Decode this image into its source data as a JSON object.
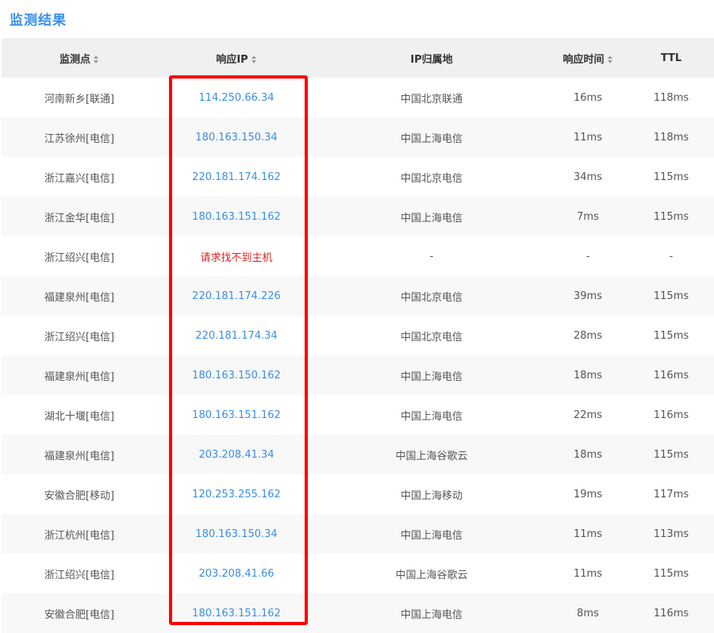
{
  "title": "监测结果",
  "columns": {
    "location": "监测点",
    "ip": "响应IP",
    "region": "IP归属地",
    "time": "响应时间",
    "ttl": "TTL"
  },
  "colors": {
    "accent": "#3a8ee6",
    "error": "#e02020",
    "highlight": "#ff0000"
  },
  "rows": [
    {
      "location": "河南新乡[联通]",
      "ip": "114.250.66.34",
      "ip_status": "ok",
      "region": "中国北京联通",
      "time": "16ms",
      "ttl": "118ms"
    },
    {
      "location": "江苏徐州[电信]",
      "ip": "180.163.150.34",
      "ip_status": "ok",
      "region": "中国上海电信",
      "time": "11ms",
      "ttl": "118ms"
    },
    {
      "location": "浙江嘉兴[电信]",
      "ip": "220.181.174.162",
      "ip_status": "ok",
      "region": "中国北京电信",
      "time": "34ms",
      "ttl": "115ms"
    },
    {
      "location": "浙江金华[电信]",
      "ip": "180.163.151.162",
      "ip_status": "ok",
      "region": "中国上海电信",
      "time": "7ms",
      "ttl": "115ms"
    },
    {
      "location": "浙江绍兴[电信]",
      "ip": "请求找不到主机",
      "ip_status": "error",
      "region": "-",
      "time": "-",
      "ttl": "-"
    },
    {
      "location": "福建泉州[电信]",
      "ip": "220.181.174.226",
      "ip_status": "ok",
      "region": "中国北京电信",
      "time": "39ms",
      "ttl": "115ms"
    },
    {
      "location": "浙江绍兴[电信]",
      "ip": "220.181.174.34",
      "ip_status": "ok",
      "region": "中国北京电信",
      "time": "28ms",
      "ttl": "115ms"
    },
    {
      "location": "福建泉州[电信]",
      "ip": "180.163.150.162",
      "ip_status": "ok",
      "region": "中国上海电信",
      "time": "18ms",
      "ttl": "116ms"
    },
    {
      "location": "湖北十堰[电信]",
      "ip": "180.163.151.162",
      "ip_status": "ok",
      "region": "中国上海电信",
      "time": "22ms",
      "ttl": "116ms"
    },
    {
      "location": "福建泉州[电信]",
      "ip": "203.208.41.34",
      "ip_status": "ok",
      "region": "中国上海谷歌云",
      "time": "18ms",
      "ttl": "115ms"
    },
    {
      "location": "安徽合肥[移动]",
      "ip": "120.253.255.162",
      "ip_status": "ok",
      "region": "中国上海移动",
      "time": "19ms",
      "ttl": "117ms"
    },
    {
      "location": "浙江杭州[电信]",
      "ip": "180.163.150.34",
      "ip_status": "ok",
      "region": "中国上海电信",
      "time": "11ms",
      "ttl": "113ms"
    },
    {
      "location": "浙江绍兴[电信]",
      "ip": "203.208.41.66",
      "ip_status": "ok",
      "region": "中国上海谷歌云",
      "time": "11ms",
      "ttl": "115ms"
    },
    {
      "location": "安徽合肥[电信]",
      "ip": "180.163.151.162",
      "ip_status": "ok",
      "region": "中国上海电信",
      "time": "8ms",
      "ttl": "116ms"
    }
  ]
}
